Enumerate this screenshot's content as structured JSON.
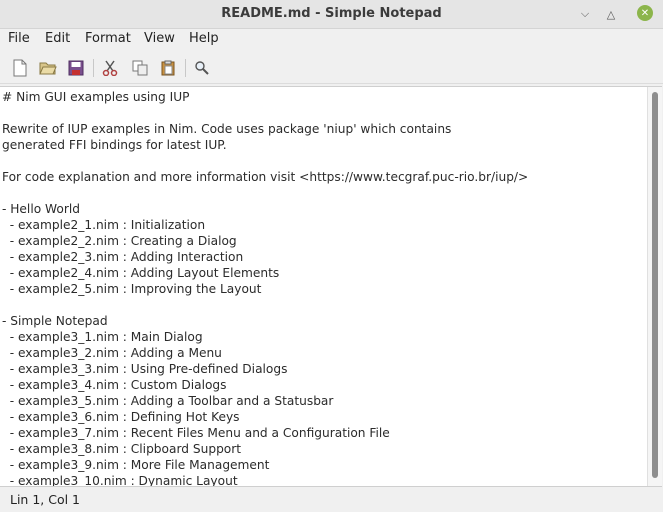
{
  "window": {
    "title": "README.md - Simple Notepad"
  },
  "menu": {
    "items": [
      "File",
      "Edit",
      "Format",
      "View",
      "Help"
    ]
  },
  "toolbar": {
    "icons": [
      "new-file-icon",
      "open-folder-icon",
      "save-icon",
      "cut-icon",
      "copy-icon",
      "paste-icon",
      "find-icon"
    ]
  },
  "editor": {
    "lines": [
      "# Nim GUI examples using IUP",
      "",
      "Rewrite of IUP examples in Nim. Code uses package 'niup' which contains",
      "generated FFI bindings for latest IUP.",
      "",
      "For code explanation and more information visit <https://www.tecgraf.puc-rio.br/iup/>",
      "",
      "- Hello World",
      "  - example2_1.nim : Initialization",
      "  - example2_2.nim : Creating a Dialog",
      "  - example2_3.nim : Adding Interaction",
      "  - example2_4.nim : Adding Layout Elements",
      "  - example2_5.nim : Improving the Layout",
      "",
      "- Simple Notepad",
      "  - example3_1.nim : Main Dialog",
      "  - example3_2.nim : Adding a Menu",
      "  - example3_3.nim : Using Pre-defined Dialogs",
      "  - example3_4.nim : Custom Dialogs",
      "  - example3_5.nim : Adding a Toolbar and a Statusbar",
      "  - example3_6.nim : Defining Hot Keys",
      "  - example3_7.nim : Recent Files Menu and a Configuration File",
      "  - example3_8.nim : Clipboard Support",
      "  - example3_9.nim : More File Management",
      "  - example3_10.nim : Dynamic Layout"
    ]
  },
  "status": {
    "text": "Lin 1, Col 1"
  }
}
